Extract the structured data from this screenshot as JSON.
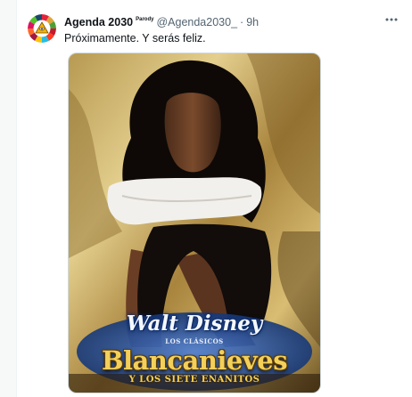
{
  "tweet": {
    "display_name": "Agenda 2030",
    "badge": "Parody",
    "handle": "@Agenda2030_",
    "separator": "·",
    "time": "9h",
    "text": "Próximamente. Y serás feliz.",
    "more_icon": "more-horizontal-icon"
  },
  "media": {
    "brand": "Walt Disney",
    "collection": "LOS CLÁSICOS",
    "title": "Blancanieves",
    "subtitle": "Y LOS SIETE ENANITOS"
  },
  "colors": {
    "text_primary": "#0f1419",
    "text_secondary": "#536471",
    "poster_gold": "#f3d05a",
    "poster_blue": "#0b2a66"
  }
}
